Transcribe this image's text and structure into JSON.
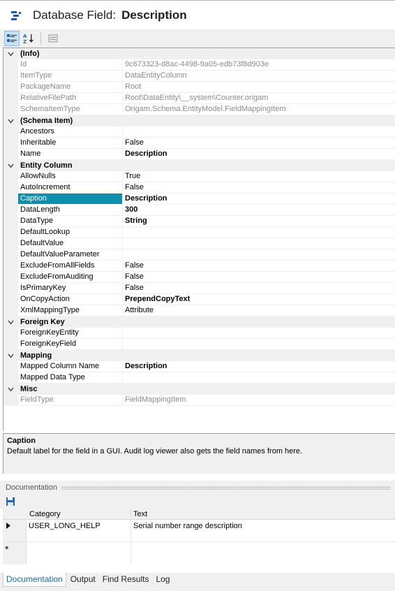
{
  "header": {
    "title_prefix": "Database Field:",
    "title_name": "Description",
    "icon": "field-icon"
  },
  "toolbar": {
    "buttons": [
      {
        "name": "categorized-icon",
        "active": true
      },
      {
        "name": "sort-alphabetical-icon",
        "active": false
      },
      {
        "name": "property-pages-icon",
        "active": false
      }
    ]
  },
  "property_grid": {
    "categories": [
      {
        "name": "(Info)",
        "properties": [
          {
            "name": "Id",
            "value": "9c673323-d8ac-4498-9a05-edb73f8d903e",
            "readonly": true
          },
          {
            "name": "ItemType",
            "value": "DataEntityColumn",
            "readonly": true
          },
          {
            "name": "PackageName",
            "value": "Root",
            "readonly": true
          },
          {
            "name": "RelativeFilePath",
            "value": "Root\\DataEntity\\__system\\Counter.origam",
            "readonly": true
          },
          {
            "name": "SchemaItemType",
            "value": "Origam.Schema.EntityModel.FieldMappingItem",
            "readonly": true
          }
        ]
      },
      {
        "name": "(Schema Item)",
        "properties": [
          {
            "name": "Ancestors",
            "value": ""
          },
          {
            "name": "Inheritable",
            "value": "False"
          },
          {
            "name": "Name",
            "value": "Description",
            "bold": true
          }
        ]
      },
      {
        "name": "Entity Column",
        "properties": [
          {
            "name": "AllowNulls",
            "value": "True"
          },
          {
            "name": "AutoIncrement",
            "value": "False"
          },
          {
            "name": "Caption",
            "value": "Description",
            "bold": true,
            "selected": true
          },
          {
            "name": "DataLength",
            "value": "300",
            "bold": true
          },
          {
            "name": "DataType",
            "value": "String",
            "bold": true
          },
          {
            "name": "DefaultLookup",
            "value": ""
          },
          {
            "name": "DefaultValue",
            "value": ""
          },
          {
            "name": "DefaultValueParameter",
            "value": ""
          },
          {
            "name": "ExcludeFromAllFields",
            "value": "False"
          },
          {
            "name": "ExcludeFromAuditing",
            "value": "False"
          },
          {
            "name": "IsPrimaryKey",
            "value": "False"
          },
          {
            "name": "OnCopyAction",
            "value": "PrependCopyText",
            "bold": true
          },
          {
            "name": "XmlMappingType",
            "value": "Attribute"
          }
        ]
      },
      {
        "name": "Foreign Key",
        "properties": [
          {
            "name": "ForeignKeyEntity",
            "value": ""
          },
          {
            "name": "ForeignKeyField",
            "value": ""
          }
        ]
      },
      {
        "name": "Mapping",
        "properties": [
          {
            "name": "Mapped Column Name",
            "value": "Description",
            "bold": true
          },
          {
            "name": "Mapped Data Type",
            "value": ""
          }
        ]
      },
      {
        "name": "Misc",
        "properties": [
          {
            "name": "FieldType",
            "value": "FieldMappingItem",
            "readonly": true
          }
        ]
      }
    ]
  },
  "help_panel": {
    "title": "Caption",
    "description": "Default label for the field in a GUI. Audit log viewer also gets the field names from here."
  },
  "documentation": {
    "header": "Documentation",
    "columns": [
      "Category",
      "Text"
    ],
    "rows": [
      {
        "category": "USER_LONG_HELP",
        "text": "Serial number range description"
      }
    ],
    "new_row_marker": "*"
  },
  "bottom_tabs": [
    {
      "label": "Documentation",
      "active": true
    },
    {
      "label": "Output",
      "active": false
    },
    {
      "label": "Find Results",
      "active": false
    },
    {
      "label": "Log",
      "active": false
    }
  ],
  "colors": {
    "selection": "#0f8eae",
    "panel": "#f0f0f0",
    "active_tab_text": "#1a6aa8"
  }
}
